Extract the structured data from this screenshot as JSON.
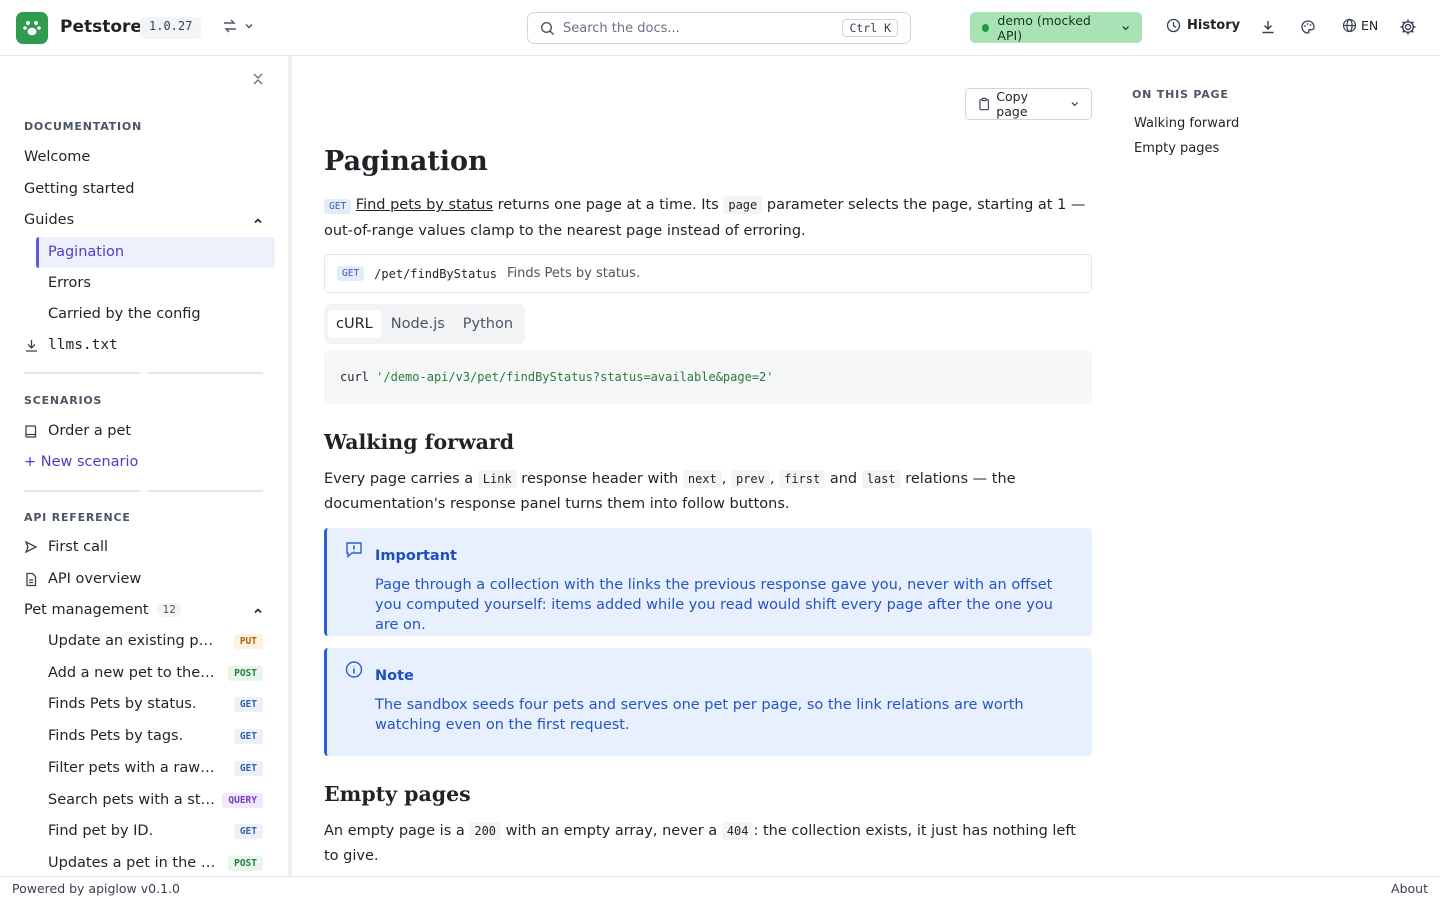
{
  "header": {
    "brand": "Petstore",
    "version": "1.0.27",
    "search_placeholder": "Search the docs...",
    "search_shortcut": "Ctrl K",
    "env_label": "demo (mocked API)",
    "history_label": "History",
    "lang_label": "EN",
    "colors": {
      "brand": "#2e9b4f",
      "env_bg": "#a9e3b5",
      "env_dot": "#1f9b45"
    }
  },
  "sidebar": {
    "documentation_heading": "DOCUMENTATION",
    "docs": [
      "Welcome",
      "Getting started"
    ],
    "guides_label": "Guides",
    "guides": [
      "Pagination",
      "Errors",
      "Carried by the config"
    ],
    "llms_label": "llms.txt",
    "scenarios_heading": "SCENARIOS",
    "scenarios": [
      "Order a pet"
    ],
    "new_scenario": "+ New scenario",
    "api_heading": "API REFERENCE",
    "api_items": [
      "First call",
      "API overview"
    ],
    "pet_group": {
      "label": "Pet management",
      "count": "12"
    },
    "operations": [
      {
        "label": "Update an existing pet.",
        "method": "PUT"
      },
      {
        "label": "Add a new pet to the st...",
        "method": "POST"
      },
      {
        "label": "Finds Pets by status.",
        "method": "GET"
      },
      {
        "label": "Finds Pets by tags.",
        "method": "GET"
      },
      {
        "label": "Filter pets with a raw qu...",
        "method": "GET"
      },
      {
        "label": "Search pets with a stru...",
        "method": "QUERY"
      },
      {
        "label": "Find pet by ID.",
        "method": "GET"
      },
      {
        "label": "Updates a pet in the st...",
        "method": "POST"
      }
    ],
    "active_color": "#5a5bd5"
  },
  "main": {
    "copy_page": "Copy page",
    "title": "Pagination",
    "intro": {
      "method": "GET",
      "link": "Find pets by status",
      "text1": " returns one page at a time. Its ",
      "code": "page",
      "text2": " parameter selects the page, starting at 1 — out-of-range values clamp to the nearest page instead of erroring."
    },
    "endpoint": {
      "method": "GET",
      "path": "/pet/findByStatus",
      "summary": "Finds Pets by status."
    },
    "tabs": [
      "cURL",
      "Node.js",
      "Python"
    ],
    "code": {
      "cmd": "curl",
      "arg": "'/demo-api/v3/pet/findByStatus?status=available&page=2'"
    },
    "walking": {
      "heading": "Walking forward",
      "t1": "Every page carries a ",
      "c1": "Link",
      "t2": " response header with ",
      "c2": "next",
      "t3": ", ",
      "c3": "prev",
      "t4": ", ",
      "c4": "first",
      "t5": " and ",
      "c5": "last",
      "t6": " relations — the documentation's response panel turns them into follow buttons."
    },
    "important": {
      "title": "Important",
      "body": "Page through a collection with the links the previous response gave you, never with an offset you computed yourself: items added while you read would shift every page after the one you are on."
    },
    "note": {
      "title": "Note",
      "body": "The sandbox seeds four pets and serves one pet per page, so the link relations are worth watching even on the first request."
    },
    "empty": {
      "heading": "Empty pages",
      "t1": "An empty page is a ",
      "c1": "200",
      "t2": " with an empty array, never a ",
      "c2": "404",
      "t3": ": the collection exists, it just has nothing left to give."
    }
  },
  "toc": {
    "heading": "ON THIS PAGE",
    "items": [
      "Walking forward",
      "Empty pages"
    ]
  },
  "footer": {
    "powered": "Powered by apiglow v0.1.0",
    "about": "About"
  }
}
